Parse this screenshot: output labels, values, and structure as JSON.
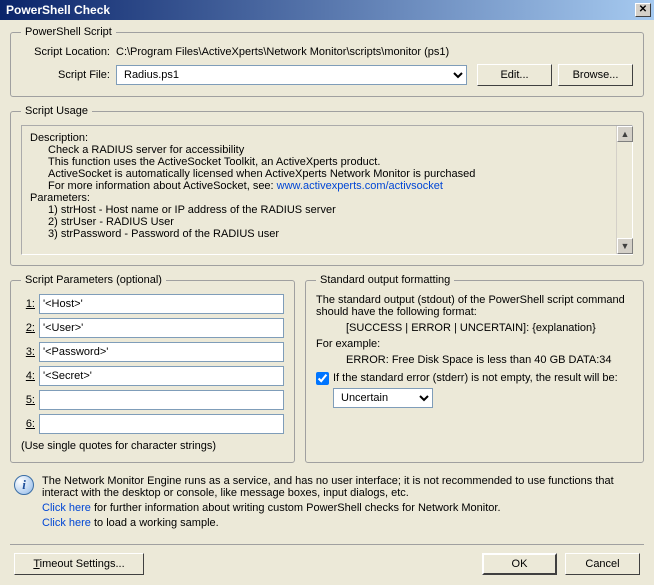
{
  "title": "PowerShell Check",
  "script_group": {
    "legend": "PowerShell Script",
    "location_label": "Script Location:",
    "location_value": "C:\\Program Files\\ActiveXperts\\Network Monitor\\scripts\\monitor (ps1)",
    "file_label": "Script File:",
    "file_value": "Radius.ps1",
    "edit_btn": "Edit...",
    "browse_btn": "Browse..."
  },
  "usage_group": {
    "legend": "Script Usage",
    "desc_label": "Description:",
    "desc_line1": "Check a RADIUS server for accessibility",
    "desc_line2": "This function uses the ActiveSocket Toolkit, an ActiveXperts product.",
    "desc_line3": "ActiveSocket is automatically licensed when ActiveXperts Network Monitor is purchased",
    "desc_line4_pre": "For more information about ActiveSocket, see: ",
    "desc_line4_link": "www.activexperts.com/activsocket",
    "params_label": "Parameters:",
    "p1": "1) strHost - Host name or IP address of the RADIUS server",
    "p2": "2) strUser - RADIUS User",
    "p3": "3) strPassword - Password of the RADIUS user"
  },
  "params_group": {
    "legend": "Script Parameters (optional)",
    "labels": [
      "1:",
      "2:",
      "3:",
      "4:",
      "5:",
      "6:"
    ],
    "values": [
      "'<Host>'",
      "'<User>'",
      "'<Password>'",
      "'<Secret>'",
      "",
      ""
    ],
    "note": "(Use single quotes for character strings)"
  },
  "stdout_group": {
    "legend": "Standard output formatting",
    "line1": "The standard output (stdout) of the PowerShell script command should have the following format:",
    "line2": "[SUCCESS | ERROR | UNCERTAIN]: {explanation}",
    "line3": "For example:",
    "line4": "ERROR: Free Disk Space is less than 40 GB DATA:34",
    "chk_label": "If the standard error (stderr) is not empty, the result will be:",
    "select_value": "Uncertain"
  },
  "info": {
    "line1": "The Network Monitor Engine runs as a service, and has no user interface; it is not recommended to use functions that interact with the desktop or console, like message boxes, input dialogs, etc.",
    "link1": "Click here",
    "link1_after": " for further information about writing custom PowerShell checks for Network Monitor.",
    "link2": "Click here",
    "link2_after": " to load a working sample."
  },
  "footer": {
    "timeout_btn": "Timeout Settings...",
    "ok_btn": "OK",
    "cancel_btn": "Cancel"
  }
}
